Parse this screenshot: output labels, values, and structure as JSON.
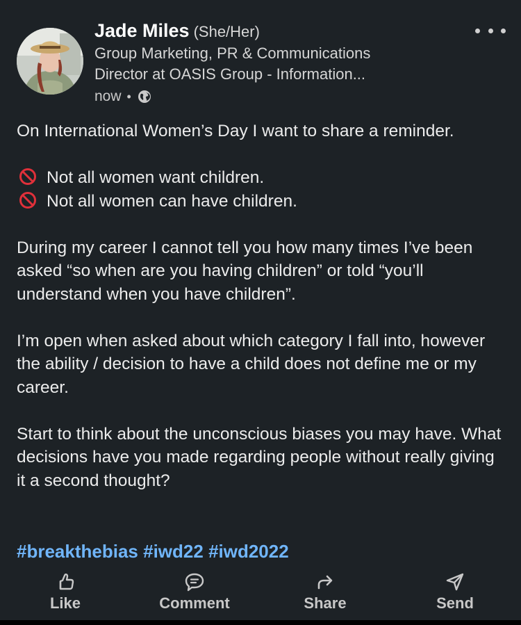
{
  "post": {
    "author": {
      "name": "Jade Miles",
      "pronouns": "(She/Her)",
      "headline_line1": "Group Marketing, PR & Communications",
      "headline_line2": "Director at OASIS Group - Information...",
      "time": "now",
      "separator": "•",
      "visibility_icon": "globe-icon"
    },
    "more_icon": "more-horizontal-icon",
    "body": {
      "p1": "On International Women’s Day I want to share a reminder.",
      "bullet1": "Not all women want children.",
      "bullet2": "Not all women can have children.",
      "bullet_icon": "prohibited-icon",
      "p3": "During my career I cannot tell you how many times I’ve been asked “so when are you having children” or told “you’ll understand when you have children”.",
      "p4": "I’m open when asked about which category I fall into, however the ability / decision to have a child does not define me or my career.",
      "p5": "Start to think about the unconscious biases you may have. What decisions have you made regarding people without really giving it a second thought?"
    },
    "hashtags": [
      "#breakthebias",
      "#iwd22",
      "#iwd2022"
    ],
    "actions": {
      "like": "Like",
      "comment": "Comment",
      "share": "Share",
      "send": "Send"
    }
  },
  "colors": {
    "background": "#1d2226",
    "hashtag": "#70b5f9",
    "bullet_icon": "#e0303a"
  }
}
